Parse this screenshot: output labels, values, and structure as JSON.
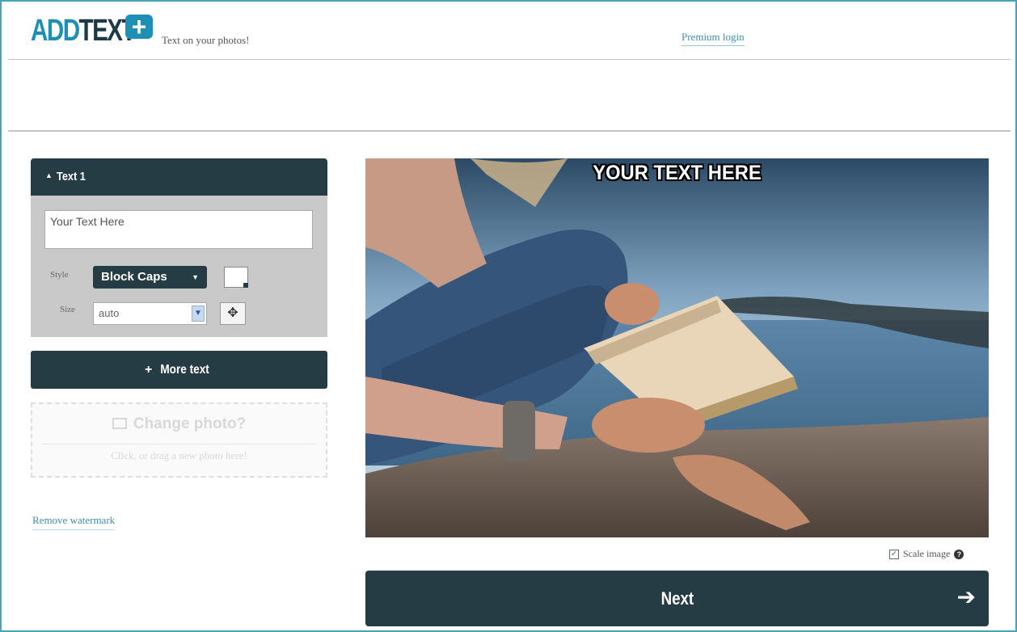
{
  "header": {
    "logo_part1": "ADD",
    "logo_part2": "TEXT",
    "logo_plus": "+",
    "tagline": "Text on your photos!",
    "premium_link": "Premium login"
  },
  "text_panel": {
    "title": "Text 1",
    "text_value": "Your Text Here",
    "style_label": "Style",
    "style_value": "Block Caps",
    "size_label": "Size",
    "size_value": "auto"
  },
  "more_text_label": "More text",
  "change_photo": {
    "title": "Change photo?",
    "hint": "Click, or drag a new photo here!"
  },
  "remove_watermark": "Remove watermark",
  "photo": {
    "overlay_text": "YOUR TEXT HERE"
  },
  "scale_image_label": "Scale image",
  "next_label": "Next",
  "colors": {
    "brand_dark": "#263c44",
    "brand_blue": "#1f8fb3",
    "link": "#3d8fa6"
  },
  "icons": {
    "collapse": "caret-up-icon",
    "color_picker": "color-swatch-icon",
    "move": "move-arrows-icon",
    "more_text": "plus-icon",
    "change_photo": "image-icon",
    "scale_checkbox": "checkbox-icon",
    "help": "help-icon",
    "next": "arrow-right-icon"
  }
}
